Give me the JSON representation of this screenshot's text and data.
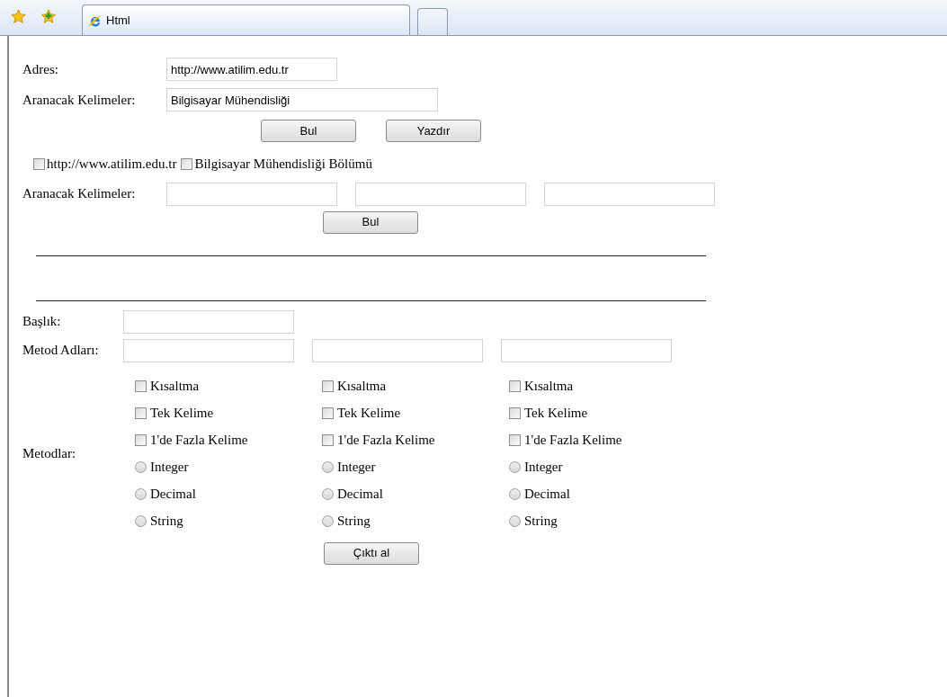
{
  "browser": {
    "tab_title": "Html"
  },
  "address": {
    "label": "Adres:",
    "value": "http://www.atilim.edu.tr"
  },
  "keywords": {
    "label": "Aranacak Kelimeler:",
    "value": "Bilgisayar Mühendisliği"
  },
  "buttons": [
    "Bul",
    "Yazdır"
  ],
  "filters": [
    {
      "label": "http://www.atilim.edu.tr",
      "checked": false
    },
    {
      "label": "Bilgisayar Mühendisliği Bölümü",
      "checked": false
    }
  ],
  "search": {
    "label": "Aranacak Kelimeler:",
    "fields": [
      {
        "kind": "text"
      },
      {
        "kind": "text"
      },
      {
        "kind": "text"
      }
    ],
    "button": "Bul"
  },
  "title_field": {
    "label": "Başlık:"
  },
  "method_names": {
    "label": "Metod Adları:",
    "fields": [
      {
        "kind": "text"
      },
      {
        "kind": "text"
      },
      {
        "kind": "text"
      }
    ]
  },
  "methods": {
    "label": "Metodlar:",
    "columns": [
      {
        "options": [
          {
            "kind": "checkbox",
            "label": "Kısaltma",
            "checked": false
          },
          {
            "kind": "checkbox",
            "label": "Tek Kelime",
            "checked": false
          },
          {
            "kind": "checkbox",
            "label": "1'de Fazla Kelime",
            "checked": false
          },
          {
            "kind": "radio",
            "label": "Integer",
            "checked": false
          },
          {
            "kind": "radio",
            "label": "Decimal",
            "checked": false
          },
          {
            "kind": "radio",
            "label": "String",
            "checked": false
          }
        ]
      },
      {
        "options": [
          {
            "kind": "checkbox",
            "label": "Kısaltma",
            "checked": false
          },
          {
            "kind": "checkbox",
            "label": "Tek Kelime",
            "checked": false
          },
          {
            "kind": "checkbox",
            "label": "1'de Fazla Kelime",
            "checked": false
          },
          {
            "kind": "radio",
            "label": "Integer",
            "checked": false
          },
          {
            "kind": "radio",
            "label": "Decimal",
            "checked": false
          },
          {
            "kind": "radio",
            "label": "String",
            "checked": false
          }
        ]
      },
      {
        "options": [
          {
            "kind": "checkbox",
            "label": "Kısaltma",
            "checked": false
          },
          {
            "kind": "checkbox",
            "label": "Tek Kelime",
            "checked": false
          },
          {
            "kind": "checkbox",
            "label": "1'de Fazla Kelime",
            "checked": false
          },
          {
            "kind": "radio",
            "label": "Integer",
            "checked": false
          },
          {
            "kind": "radio",
            "label": "Decimal",
            "checked": false
          },
          {
            "kind": "radio",
            "label": "String",
            "checked": false
          }
        ]
      }
    ]
  },
  "output_button": "Çıktı al"
}
